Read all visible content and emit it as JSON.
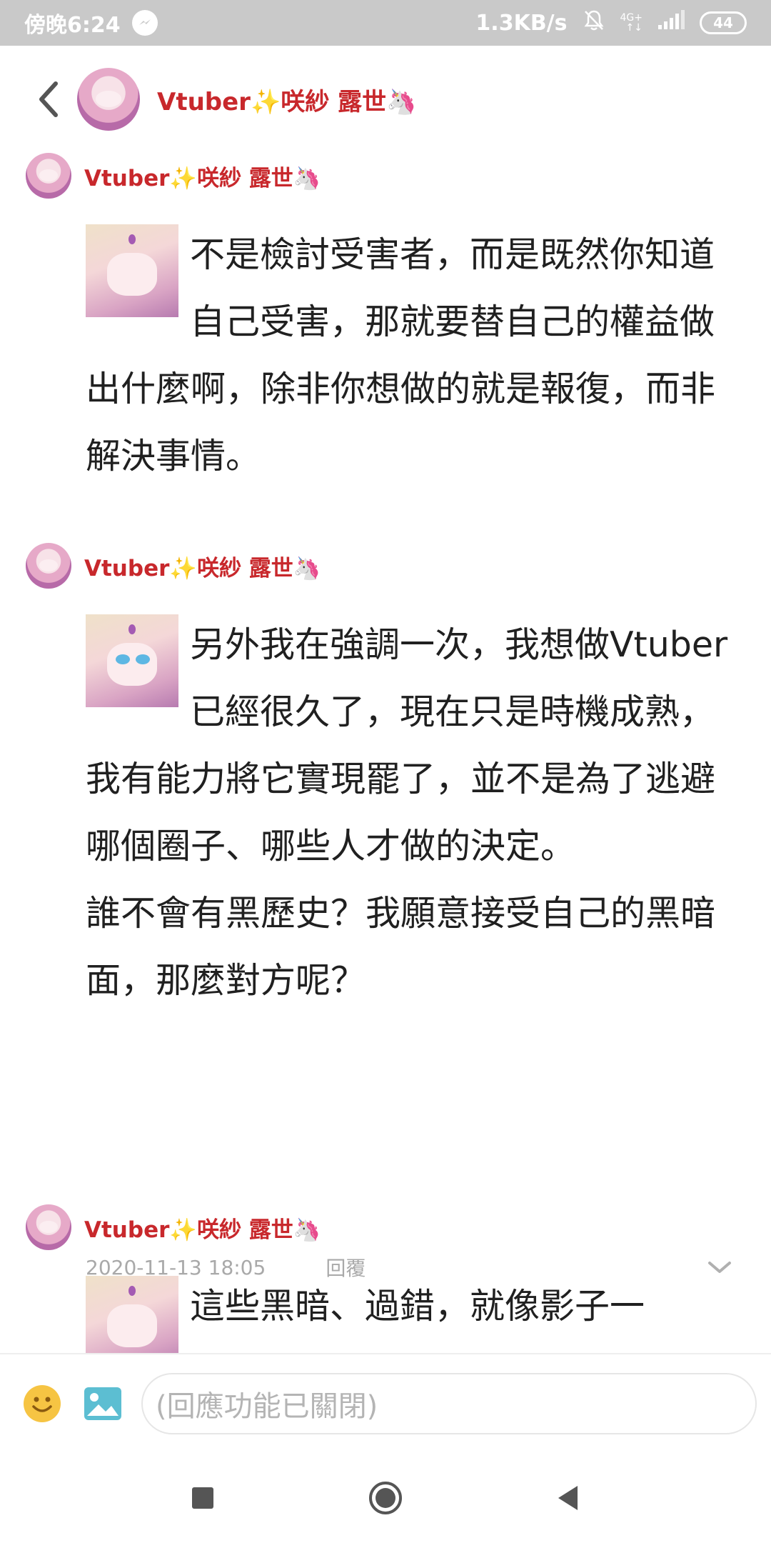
{
  "status": {
    "time": "傍晚6:24",
    "speed": "1.3KB/s",
    "network_top": "4G+",
    "network_bottom": "↑↓",
    "battery": "44"
  },
  "header": {
    "user_name": "Vtuber",
    "user_name_suffix": "咲紗 露世",
    "sparkle": "✨",
    "unicorn": "🦄"
  },
  "posts": [
    {
      "author": "Vtuber",
      "author_suffix": "咲紗 露世",
      "text": "不是檢討受害者，而是既然你知道自己受害，那就要替自己的權益做出什麼啊，除非你想做的就是報復，而非解決事情。"
    },
    {
      "author": "Vtuber",
      "author_suffix": "咲紗 露世",
      "text": "另外我在強調一次，我想做Vtuber已經很久了，現在只是時機成熟，我有能力將它實現罷了，並不是為了逃避哪個圈子、哪些人才做的決定。",
      "text2": "誰不會有黑歷史？我願意接受自己的黑暗面，那麼對方呢？",
      "date": "2020-11-13 18:05",
      "reply_label": "回覆"
    },
    {
      "author": "Vtuber",
      "author_suffix": "咲紗 露世",
      "text": "這些黑暗、過錯，就像影子一"
    }
  ],
  "input": {
    "placeholder": "(回應功能已關閉)"
  },
  "colors": {
    "name": "#c8282c",
    "statusbar": "#c9c9c9",
    "meta": "#a9a9a9"
  },
  "icons": [
    "back-arrow-icon",
    "messenger-icon",
    "bell-off-icon",
    "signal-icon",
    "battery-icon",
    "emoji-icon",
    "image-icon",
    "chevron-down-icon",
    "nav-square-icon",
    "nav-home-icon",
    "nav-back-icon"
  ]
}
